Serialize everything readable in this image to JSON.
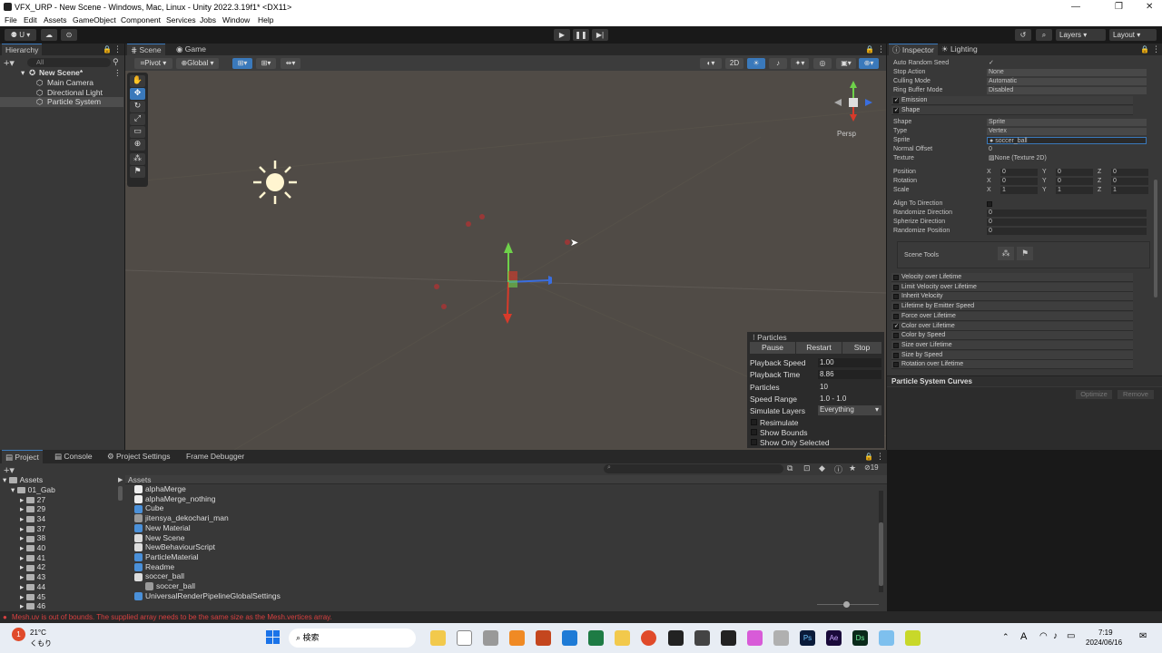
{
  "window": {
    "title": "VFX_URP - New Scene - Windows, Mac, Linux - Unity 2022.3.19f1* <DX11>"
  },
  "menu": [
    "File",
    "Edit",
    "Assets",
    "GameObject",
    "Component",
    "Services",
    "Jobs",
    "Window",
    "Help"
  ],
  "toolbar": {
    "account": "U",
    "layers": "Layers",
    "layout": "Layout"
  },
  "hierarchy": {
    "tab": "Hierarchy",
    "search": "All",
    "scene": "New Scene*",
    "items": [
      "Main Camera",
      "Directional Light",
      "Particle System"
    ]
  },
  "scene": {
    "tabs": [
      "Scene",
      "Game"
    ],
    "pivot": "Pivot",
    "global": "Global",
    "mode2d": "2D",
    "persp": "Persp"
  },
  "particles": {
    "title": "Particles",
    "buttons": [
      "Pause",
      "Restart",
      "Stop"
    ],
    "rows": [
      {
        "label": "Playback Speed",
        "value": "1.00"
      },
      {
        "label": "Playback Time",
        "value": "8.86"
      },
      {
        "label": "Particles",
        "value": "10"
      },
      {
        "label": "Speed Range",
        "value": "1.0 - 1.0"
      },
      {
        "label": "Simulate Layers",
        "value": "Everything"
      }
    ],
    "checks": [
      "Resimulate",
      "Show Bounds",
      "Show Only Selected"
    ]
  },
  "inspector": {
    "tabs": [
      "Inspector",
      "Lighting"
    ],
    "props_top": [
      {
        "label": "Auto Random Seed",
        "value": "✓"
      },
      {
        "label": "Stop Action",
        "value": "None"
      },
      {
        "label": "Culling Mode",
        "value": "Automatic"
      },
      {
        "label": "Ring Buffer Mode",
        "value": "Disabled"
      }
    ],
    "module_emission": "Emission",
    "module_shape": "Shape",
    "shape_props": [
      {
        "label": "Shape",
        "value": "Sprite"
      },
      {
        "label": "Type",
        "value": "Vertex"
      },
      {
        "label": "Sprite",
        "value": "soccer_ball"
      },
      {
        "label": "Normal Offset",
        "value": "0"
      },
      {
        "label": "Texture",
        "value": "None (Texture 2D)"
      }
    ],
    "transform": [
      {
        "label": "Position",
        "x": "0",
        "y": "0",
        "z": "0"
      },
      {
        "label": "Rotation",
        "x": "0",
        "y": "0",
        "z": "0"
      },
      {
        "label": "Scale",
        "x": "1",
        "y": "1",
        "z": "1"
      }
    ],
    "dir_props": [
      {
        "label": "Align To Direction",
        "value": ""
      },
      {
        "label": "Randomize Direction",
        "value": "0"
      },
      {
        "label": "Spherize Direction",
        "value": "0"
      },
      {
        "label": "Randomize Position",
        "value": "0"
      }
    ],
    "scene_tools": "Scene Tools",
    "modules": [
      {
        "label": "Velocity over Lifetime",
        "checked": false
      },
      {
        "label": "Limit Velocity over Lifetime",
        "checked": false
      },
      {
        "label": "Inherit Velocity",
        "checked": false
      },
      {
        "label": "Lifetime by Emitter Speed",
        "checked": false
      },
      {
        "label": "Force over Lifetime",
        "checked": false
      },
      {
        "label": "Color over Lifetime",
        "checked": true
      },
      {
        "label": "Color by Speed",
        "checked": false
      },
      {
        "label": "Size over Lifetime",
        "checked": false
      },
      {
        "label": "Size by Speed",
        "checked": false
      },
      {
        "label": "Rotation over Lifetime",
        "checked": false
      }
    ],
    "curves_title": "Particle System Curves",
    "optimize": "Optimize",
    "remove": "Remove"
  },
  "project": {
    "tabs": [
      "Project",
      "Console",
      "Project Settings",
      "Frame Debugger"
    ],
    "tree_root": "Assets",
    "tree_folder": "01_Gab",
    "tree_items": [
      "27",
      "29",
      "34",
      "37",
      "38",
      "40",
      "41",
      "42",
      "43",
      "44",
      "45",
      "46"
    ],
    "assets_header": "Assets",
    "assets": [
      {
        "name": "alphaMerge",
        "icon": "#eeeeee"
      },
      {
        "name": "alphaMerge_nothing",
        "icon": "#eeeeee"
      },
      {
        "name": "Cube",
        "icon": "#4a90d9"
      },
      {
        "name": "jitensya_dekochari_man",
        "icon": "#9a9a9a"
      },
      {
        "name": "New Material",
        "icon": "#4a90d9"
      },
      {
        "name": "New Scene",
        "icon": "#dddddd"
      },
      {
        "name": "NewBehaviourScript",
        "icon": "#dddddd"
      },
      {
        "name": "ParticleMaterial",
        "icon": "#4a90d9"
      },
      {
        "name": "Readme",
        "icon": "#4a90d9"
      },
      {
        "name": "soccer_ball",
        "icon": "#dddddd"
      },
      {
        "name": "soccer_ball",
        "icon": "#9a9a9a"
      },
      {
        "name": "UniversalRenderPipelineGlobalSettings",
        "icon": "#4a90d9"
      }
    ],
    "count": "19"
  },
  "status": {
    "error": "Mesh.uv is out of bounds. The supplied array needs to be the same size as the Mesh.vertices array."
  },
  "taskbar": {
    "weather_temp": "21°C",
    "weather_desc": "くもり",
    "search": "検索",
    "time": "7:19",
    "date": "2024/06/16",
    "ime": "A"
  },
  "colors": {
    "accent": "#3a79bb",
    "scene_bg": "#504b46",
    "error": "#d84040"
  }
}
